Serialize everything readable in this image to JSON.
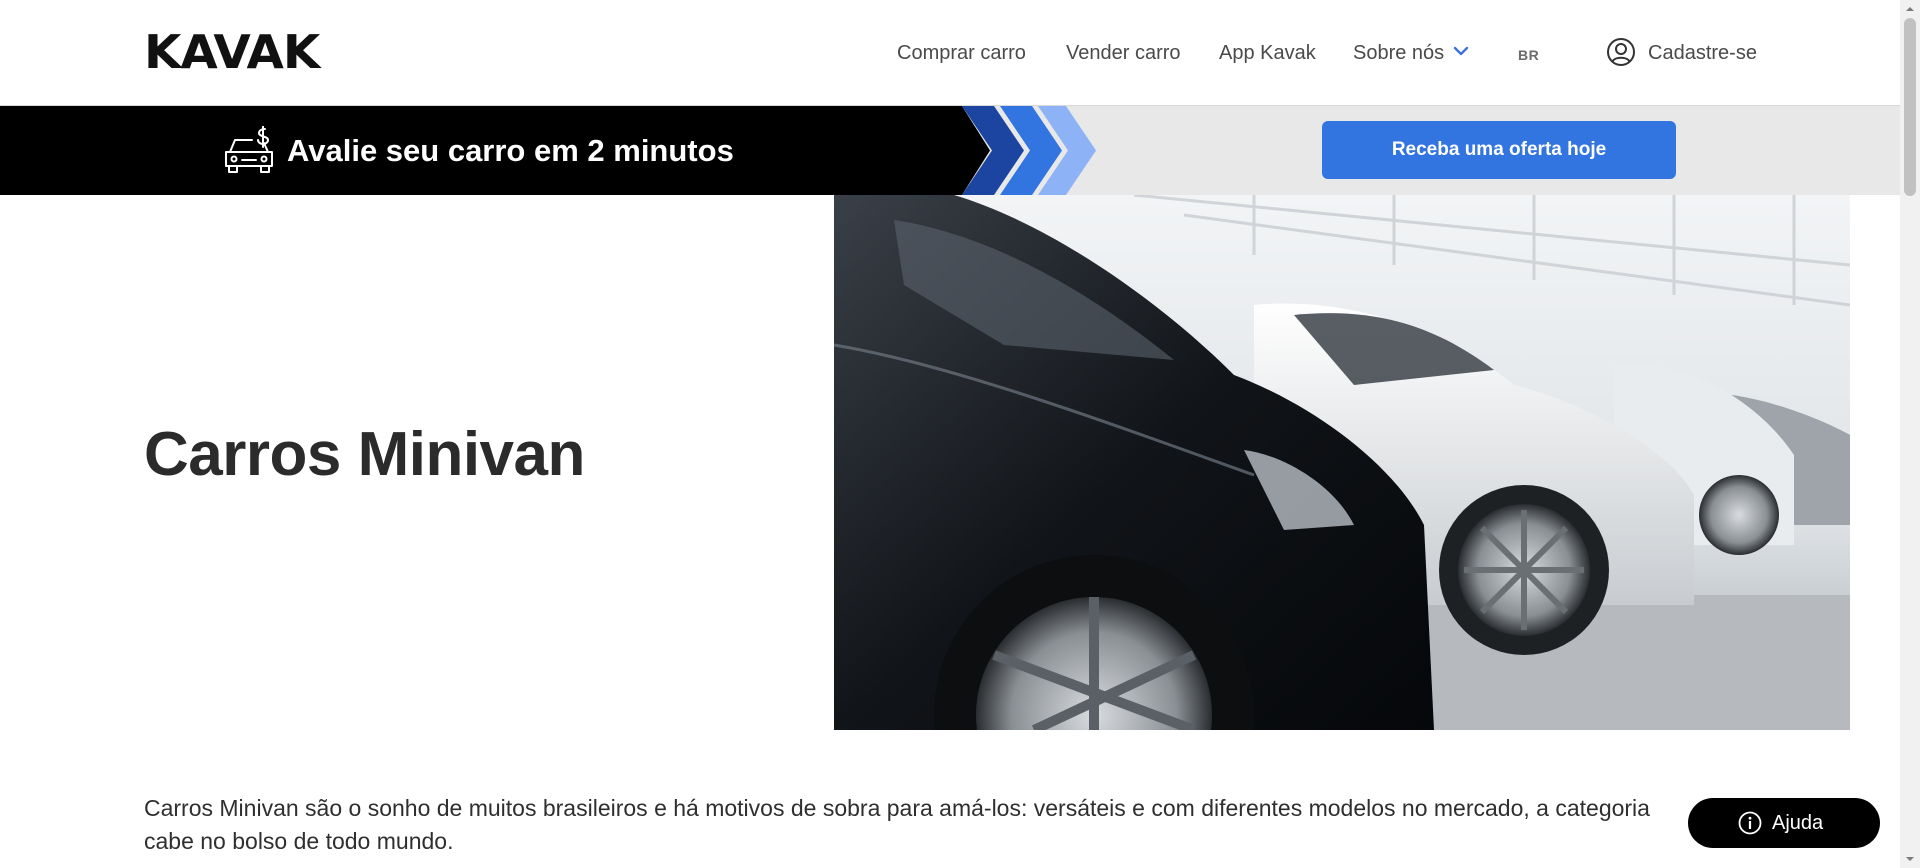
{
  "header": {
    "logo": "KAVAK",
    "nav": [
      "Comprar carro",
      "Vender carro",
      "App Kavak",
      "Sobre nós"
    ],
    "lang": "BR",
    "signup": "Cadastre-se",
    "icons": {
      "dropdown": "chevron-down-icon",
      "user": "user-circle-icon"
    },
    "colors": {
      "chevron": "#3c74d9"
    }
  },
  "banner": {
    "text": "Avalie seu carro em 2 minutos",
    "cta": "Receba uma oferta hoje",
    "icon": "car-money-icon",
    "colors": {
      "cta_bg": "#3274e0",
      "arrow_dark": "#1b45a0",
      "arrow_mid": "#3274e0",
      "arrow_light": "#8db2f5"
    }
  },
  "hero": {
    "title": "Carros Minivan",
    "image": "parked-cars-photo"
  },
  "intro": {
    "text": "Carros Minivan são o sonho de muitos brasileiros e há motivos de sobra para amá-los: versáteis e com diferentes modelos no mercado, a categoria cabe no bolso de todo mundo."
  },
  "help": {
    "label": "Ajuda",
    "icon": "info-icon"
  }
}
